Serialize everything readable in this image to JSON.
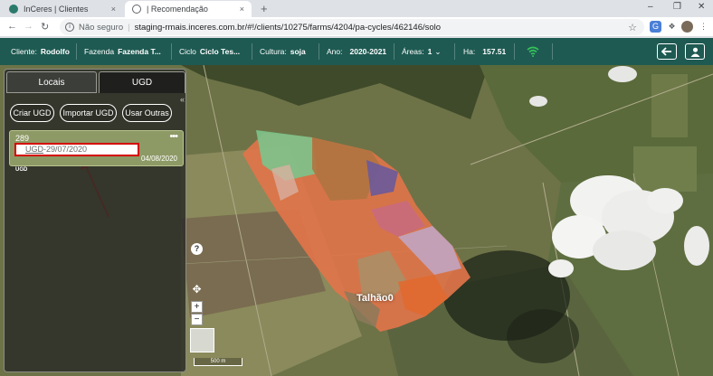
{
  "browser": {
    "tabs": [
      {
        "title": "InCeres | Clientes",
        "active": false
      },
      {
        "title": "| Recomendação",
        "active": true
      }
    ],
    "new_tab": "+",
    "close_glyph": "×",
    "address": {
      "security_label": "Não seguro",
      "url": "staging-rmais.inceres.com.br/#!/clients/10275/farms/4204/pa-cycles/462146/solo"
    }
  },
  "header": {
    "cliente_label": "Cliente:",
    "cliente_value": "Rodolfo",
    "fazenda_label": "Fazenda",
    "fazenda_value": "Fazenda T...",
    "ciclo_label": "Ciclo",
    "ciclo_value": "Ciclo Tes...",
    "cultura_label": "Cultura:",
    "cultura_value": "soja",
    "ano_label": "Ano:",
    "ano_value": "2020-2021",
    "areas_label": "Áreas:",
    "areas_value": "1",
    "ha_label": "Ha:",
    "ha_value": "157.51",
    "colors": {
      "bar": "#1e5a52",
      "wifi": "#36c25a"
    }
  },
  "panel": {
    "tabs": [
      "Locais",
      "UGD"
    ],
    "active_tab": "UGD",
    "buttons": [
      "Criar UGD",
      "Importar UGD",
      "Usar Outras"
    ],
    "card": {
      "number": "289",
      "name_prefix": "UGD",
      "name_suffix": "-29/07/2020",
      "date": "04/08/2020",
      "badge": "UGD"
    }
  },
  "map": {
    "field_label": "Talhão",
    "field_label_suffix": "0",
    "help": "?",
    "zoom_in": "+",
    "zoom_out": "−",
    "scale_label": "500 m"
  }
}
